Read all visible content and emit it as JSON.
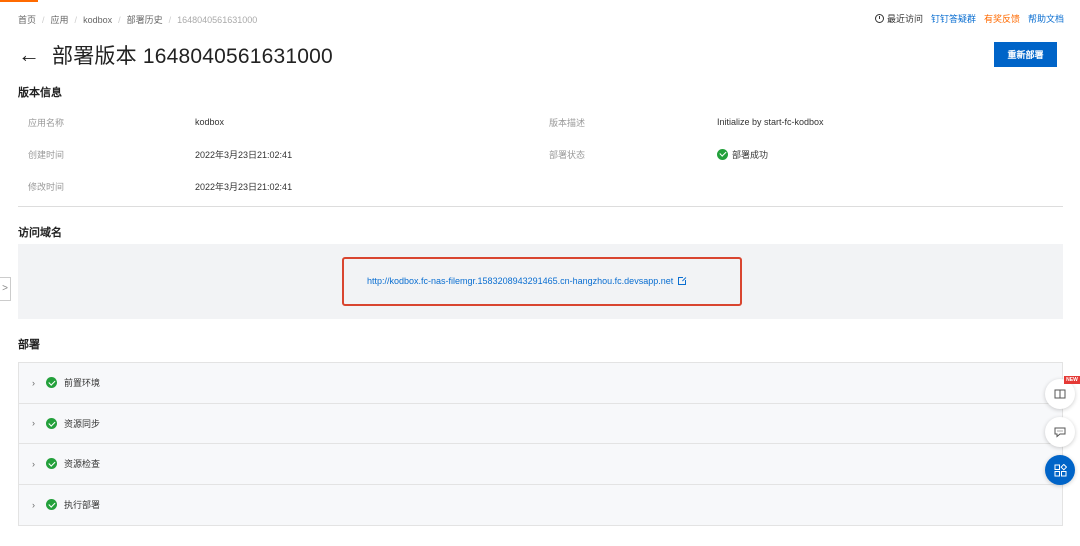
{
  "breadcrumb": [
    "首页",
    "应用",
    "kodbox",
    "部署历史",
    "1648040561631000"
  ],
  "toplinks": {
    "recent": "最近访问",
    "dingding": "钉钉答疑群",
    "feedback": "有奖反馈",
    "help": "帮助文档"
  },
  "header": {
    "back_icon": "back-arrow-icon",
    "title": "部署版本 1648040561631000",
    "redeploy_label": "重新部署"
  },
  "version_info": {
    "section_title": "版本信息",
    "app_name_label": "应用名称",
    "app_name_value": "kodbox",
    "desc_label": "版本描述",
    "desc_value": "Initialize by start-fc-kodbox",
    "created_label": "创建时间",
    "created_value": "2022年3月23日21:02:41",
    "status_label": "部署状态",
    "status_value": "部署成功",
    "modified_label": "修改时间",
    "modified_value": "2022年3月23日21:02:41"
  },
  "domain": {
    "section_title": "访问域名",
    "url": "http://kodbox.fc-nas-filemgr.1583208943291465.cn-hangzhou.fc.devsapp.net"
  },
  "deploy": {
    "section_title": "部署",
    "steps": [
      "前置环境",
      "资源同步",
      "资源检查",
      "执行部署"
    ]
  },
  "floating": {
    "new_badge": "NEW"
  },
  "colors": {
    "primary": "#0064c8",
    "link": "#0a6ed1",
    "accent": "#ff6a00",
    "success": "#23a03b",
    "highlight": "#d9452f"
  }
}
